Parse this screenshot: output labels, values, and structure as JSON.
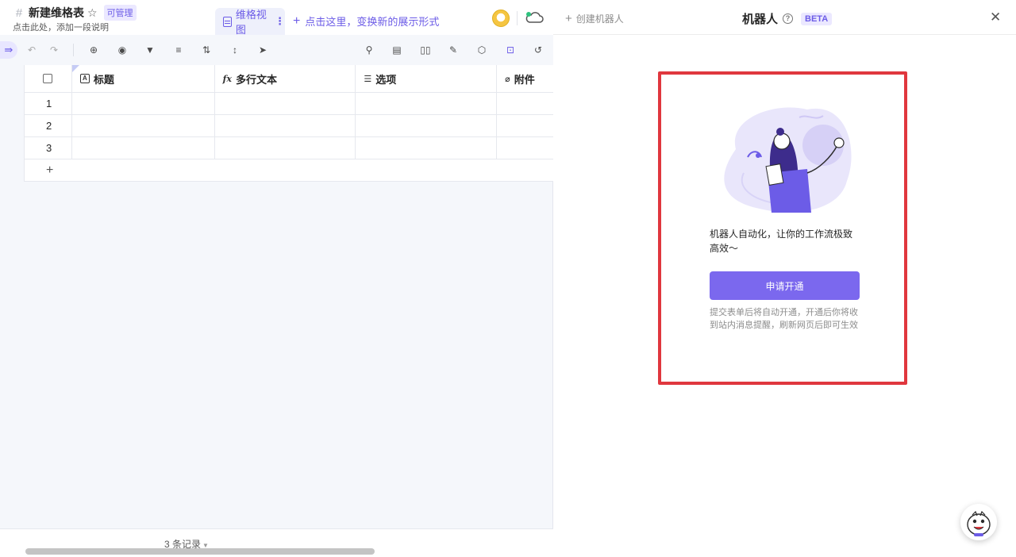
{
  "sheet": {
    "title": "新建维格表",
    "manage_badge": "可管理",
    "description": "点击此处，添加一段说明"
  },
  "view": {
    "active_tab": "维格视图",
    "add_view_label": "点击这里，变换新的展示形式"
  },
  "toolbar": {
    "icons": [
      "sidebar-toggle-icon",
      "undo-icon",
      "redo-icon",
      "add-record-icon",
      "hide-fields-icon",
      "filter-icon",
      "group-icon",
      "sort-icon",
      "row-height-icon",
      "share-icon",
      "search-icon",
      "form-icon",
      "gallery-icon",
      "widget-icon",
      "api-icon",
      "robot-icon",
      "history-icon"
    ]
  },
  "grid": {
    "columns": [
      {
        "label": "标题",
        "icon": "A"
      },
      {
        "label": "多行文本",
        "icon": "fx"
      },
      {
        "label": "选项",
        "icon": "list"
      },
      {
        "label": "附件",
        "icon": "clip"
      }
    ],
    "rows": [
      "1",
      "2",
      "3"
    ],
    "add_row": "+"
  },
  "footer": {
    "record_count": "3 条记录"
  },
  "robot_panel": {
    "create_label": "创建机器人",
    "title": "机器人",
    "beta": "BETA",
    "intro": "机器人自动化，让你的工作流极致高效～",
    "apply_button": "申请开通",
    "note": "提交表单后将自动开通，开通后你将收到站内消息提醒，刷新网页后即可生效"
  },
  "colors": {
    "accent": "#7b68ee",
    "highlight_border": "#e0373e",
    "badge_bg": "#ebe8ff"
  }
}
